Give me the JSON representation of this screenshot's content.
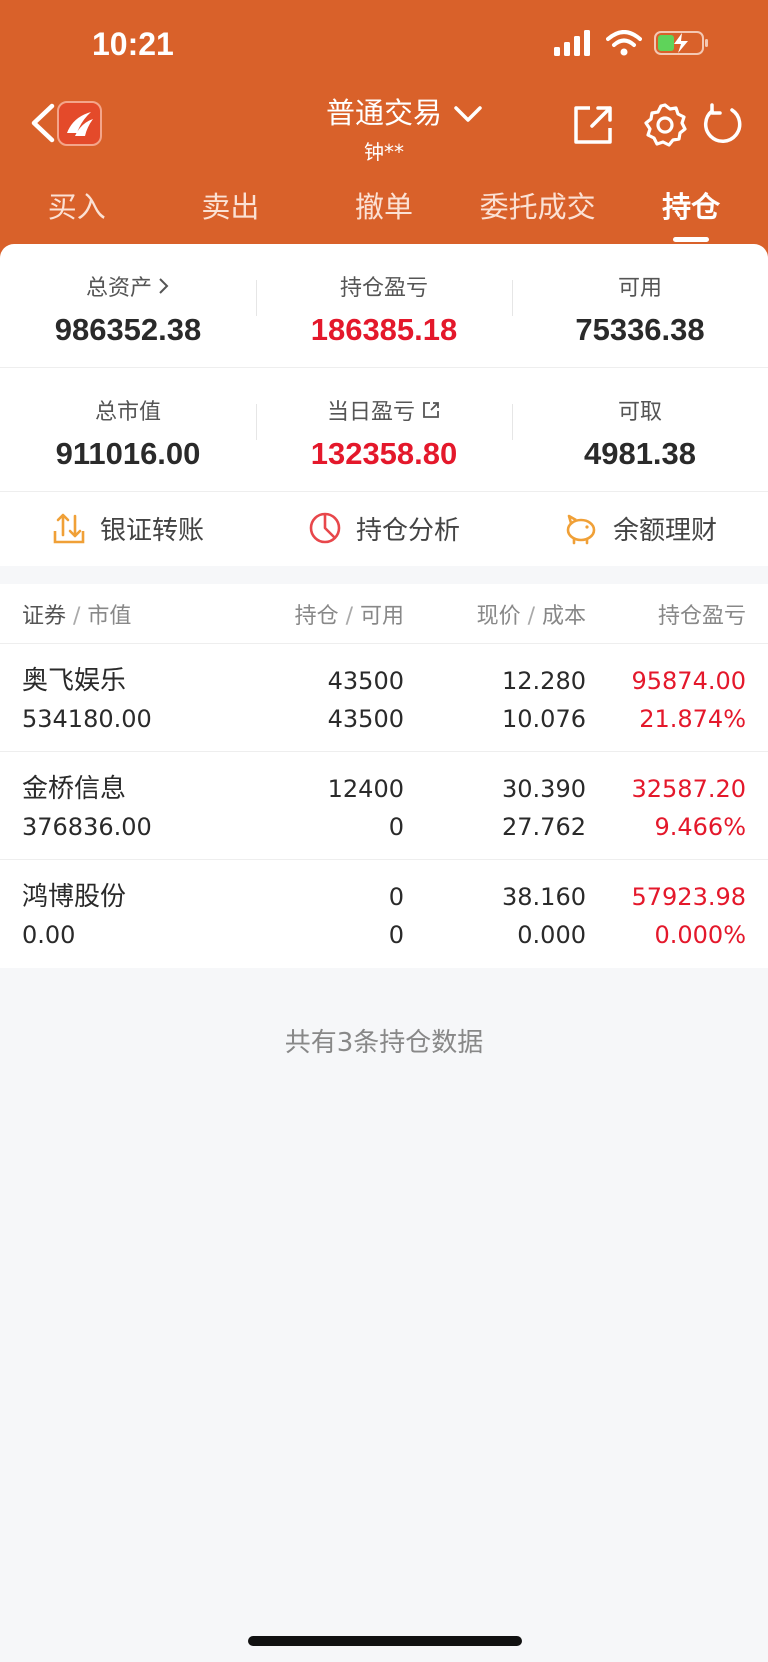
{
  "status_bar": {
    "time": "10:21"
  },
  "header": {
    "title": "普通交易",
    "subtitle": "钟**",
    "colors": {
      "brand": "#d9612a"
    }
  },
  "tabs": [
    {
      "label": "买入"
    },
    {
      "label": "卖出"
    },
    {
      "label": "撤单"
    },
    {
      "label": "委托成交"
    },
    {
      "label": "持仓"
    }
  ],
  "summary": {
    "total_assets": {
      "label": "总资产",
      "value": "986352.38"
    },
    "position_pnl": {
      "label": "持仓盈亏",
      "value": "186385.18"
    },
    "available": {
      "label": "可用",
      "value": "75336.38"
    },
    "market_value": {
      "label": "总市值",
      "value": "911016.00"
    },
    "daily_pnl": {
      "label": "当日盈亏",
      "value": "132358.80"
    },
    "withdrawable": {
      "label": "可取",
      "value": "4981.38"
    }
  },
  "actions": [
    {
      "label": "银证转账",
      "icon": "transfer-icon"
    },
    {
      "label": "持仓分析",
      "icon": "pie-chart-icon"
    },
    {
      "label": "余额理财",
      "icon": "piggy-bank-icon"
    }
  ],
  "table": {
    "headers": {
      "c1a": "证券",
      "c1b": "市值",
      "c2a": "持仓",
      "c2b": "可用",
      "c3a": "现价",
      "c3b": "成本",
      "c4": "持仓盈亏"
    },
    "rows": [
      {
        "name": "奥飞娱乐",
        "market_value": "534180.00",
        "position": "43500",
        "available": "43500",
        "price": "12.280",
        "cost": "10.076",
        "pnl": "95874.00",
        "pnl_pct": "21.874%"
      },
      {
        "name": "金桥信息",
        "market_value": "376836.00",
        "position": "12400",
        "available": "0",
        "price": "30.390",
        "cost": "27.762",
        "pnl": "32587.20",
        "pnl_pct": "9.466%"
      },
      {
        "name": "鸿博股份",
        "market_value": "0.00",
        "position": "0",
        "available": "0",
        "price": "38.160",
        "cost": "0.000",
        "pnl": "57923.98",
        "pnl_pct": "0.000%"
      }
    ]
  },
  "footer_note": "共有3条持仓数据"
}
